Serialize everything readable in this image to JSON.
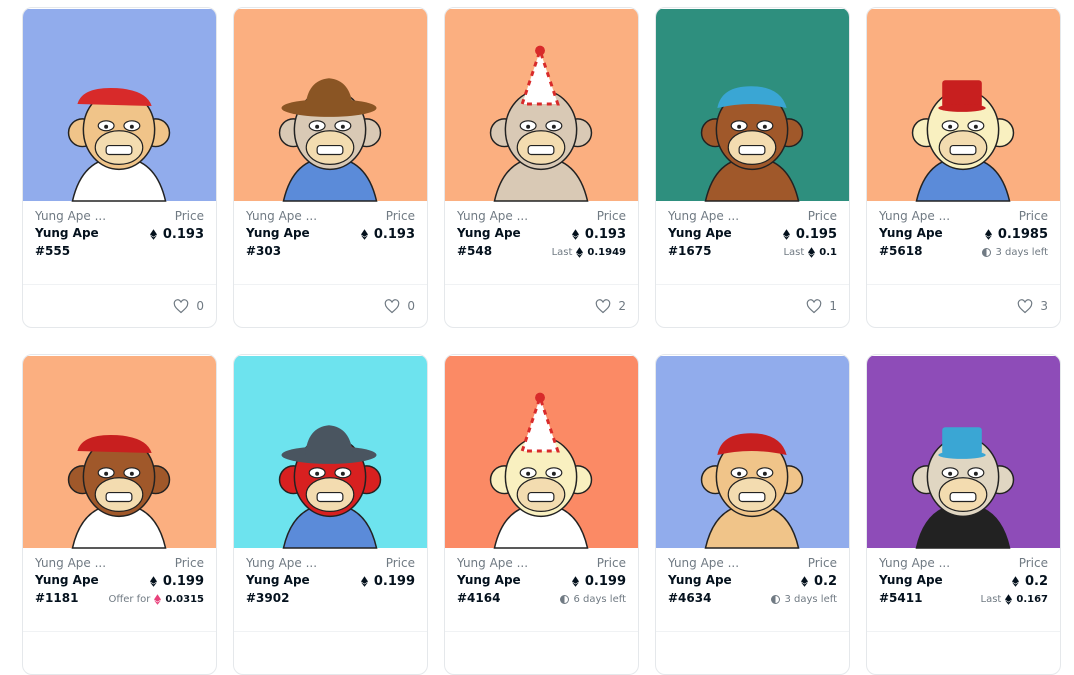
{
  "cards": [
    {
      "collection": "Yung Ape ...",
      "price_label": "Price",
      "name": "Yung Ape",
      "number": "#555",
      "price": "0.193",
      "sub_type": "none",
      "sub_label": "",
      "sub_value": "",
      "likes": "0",
      "bg": "#91acec",
      "fur": "#f0c489",
      "hat": "#d82a2a",
      "shirt": "#ffffff"
    },
    {
      "collection": "Yung Ape ...",
      "price_label": "Price",
      "name": "Yung Ape",
      "number": "#303",
      "price": "0.193",
      "sub_type": "none",
      "sub_label": "",
      "sub_value": "",
      "likes": "0",
      "bg": "#fbaf80",
      "fur": "#d9c9b5",
      "hat": "#8a5524",
      "shirt": "#5b8bd9"
    },
    {
      "collection": "Yung Ape ...",
      "price_label": "Price",
      "name": "Yung Ape",
      "number": "#548",
      "price": "0.193",
      "sub_type": "last",
      "sub_label": "Last",
      "sub_value": "0.1949",
      "likes": "2",
      "bg": "#fbaf80",
      "fur": "#d9c9b5",
      "hat": "#ffffff",
      "shirt": "#d9c9b5"
    },
    {
      "collection": "Yung Ape ...",
      "price_label": "Price",
      "name": "Yung Ape",
      "number": "#1675",
      "price": "0.195",
      "sub_type": "last",
      "sub_label": "Last",
      "sub_value": "0.1",
      "likes": "1",
      "bg": "#2e8f7e",
      "fur": "#a0582a",
      "hat": "#3aa6d4",
      "shirt": "#a0582a"
    },
    {
      "collection": "Yung Ape ...",
      "price_label": "Price",
      "name": "Yung Ape",
      "number": "#5618",
      "price": "0.1985",
      "sub_type": "time",
      "sub_label": "3 days left",
      "sub_value": "",
      "likes": "3",
      "bg": "#fbaf80",
      "fur": "#f9f0c0",
      "hat": "#c81f1f",
      "shirt": "#5b8bd9"
    },
    {
      "collection": "Yung Ape ...",
      "price_label": "Price",
      "name": "Yung Ape",
      "number": "#1181",
      "price": "0.199",
      "sub_type": "offer",
      "sub_label": "Offer for",
      "sub_value": "0.0315",
      "likes": "",
      "bg": "#fbaf80",
      "fur": "#a0582a",
      "hat": "#c81f1f",
      "shirt": "#ffffff"
    },
    {
      "collection": "Yung Ape ...",
      "price_label": "Price",
      "name": "Yung Ape",
      "number": "#3902",
      "price": "0.199",
      "sub_type": "none",
      "sub_label": "",
      "sub_value": "",
      "likes": "",
      "bg": "#6de3ee",
      "fur": "#d82020",
      "hat": "#4a5560",
      "shirt": "#5b8bd9"
    },
    {
      "collection": "Yung Ape ...",
      "price_label": "Price",
      "name": "Yung Ape",
      "number": "#4164",
      "price": "0.199",
      "sub_type": "time",
      "sub_label": "6 days left",
      "sub_value": "",
      "likes": "",
      "bg": "#fb8a65",
      "fur": "#f9f0c0",
      "hat": "#ffffff",
      "shirt": "#ffffff"
    },
    {
      "collection": "Yung Ape ...",
      "price_label": "Price",
      "name": "Yung Ape",
      "number": "#4634",
      "price": "0.2",
      "sub_type": "time",
      "sub_label": "3 days left",
      "sub_value": "",
      "likes": "",
      "bg": "#91acec",
      "fur": "#f0c489",
      "hat": "#c81f1f",
      "shirt": "#f0c489"
    },
    {
      "collection": "Yung Ape ...",
      "price_label": "Price",
      "name": "Yung Ape",
      "number": "#5411",
      "price": "0.2",
      "sub_type": "last",
      "sub_label": "Last",
      "sub_value": "0.167",
      "likes": "",
      "bg": "#8e4cb8",
      "fur": "#e0d6c2",
      "hat": "#3aa6d4",
      "shirt": "#222222"
    }
  ]
}
